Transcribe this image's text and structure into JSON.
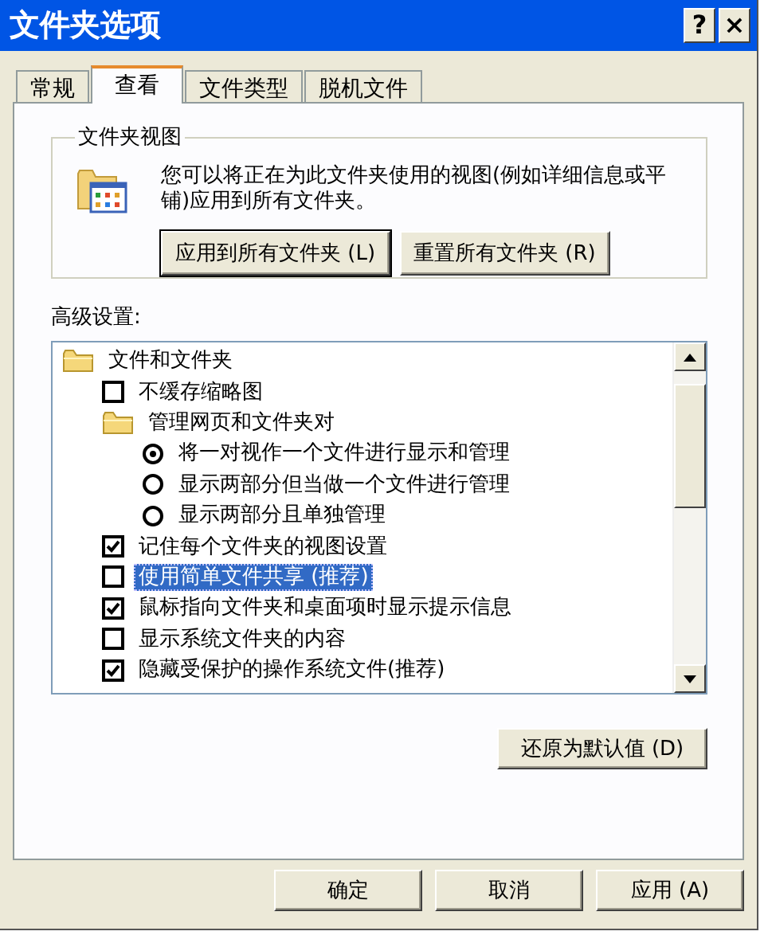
{
  "window": {
    "title": "文件夹选项",
    "help_button": "?",
    "close_button": "×"
  },
  "tabs": [
    {
      "label": "常规",
      "selected": false
    },
    {
      "label": "查看",
      "selected": true
    },
    {
      "label": "文件类型",
      "selected": false
    },
    {
      "label": "脱机文件",
      "selected": false
    }
  ],
  "folder_views": {
    "title": "文件夹视图",
    "description": "您可以将正在为此文件夹使用的视图(例如详细信息或平铺)应用到所有文件夹。",
    "buttons": [
      {
        "label": "应用到所有文件夹 (L)",
        "default": true
      },
      {
        "label": "重置所有文件夹 (R)",
        "default": false
      }
    ]
  },
  "advanced": {
    "label": "高级设置:",
    "items": [
      {
        "kind": "folder",
        "label": "文件和文件夹",
        "selected": false,
        "children": [
          {
            "kind": "checkbox",
            "label": "不缓存缩略图",
            "checked": false,
            "selected": false
          },
          {
            "kind": "folder",
            "label": "管理网页和文件夹对",
            "selected": false,
            "children": [
              {
                "kind": "radio",
                "label": "将一对视作一个文件进行显示和管理",
                "checked": true,
                "selected": false
              },
              {
                "kind": "radio",
                "label": "显示两部分但当做一个文件进行管理",
                "checked": false,
                "selected": false
              },
              {
                "kind": "radio",
                "label": "显示两部分且单独管理",
                "checked": false,
                "selected": false
              }
            ]
          },
          {
            "kind": "checkbox",
            "label": "记住每个文件夹的视图设置",
            "checked": true,
            "selected": false
          },
          {
            "kind": "checkbox",
            "label": "使用简单文件共享 (推荐)",
            "checked": false,
            "selected": true
          },
          {
            "kind": "checkbox",
            "label": "鼠标指向文件夹和桌面项时显示提示信息",
            "checked": true,
            "selected": false
          },
          {
            "kind": "checkbox",
            "label": "显示系统文件夹的内容",
            "checked": false,
            "selected": false
          },
          {
            "kind": "checkbox",
            "label": "隐藏受保护的操作系统文件(推荐)",
            "checked": true,
            "selected": false
          }
        ]
      }
    ],
    "restore_button": "还原为默认值 (D)"
  },
  "footer_buttons": [
    "确定",
    "取消",
    "应用 (A)"
  ]
}
